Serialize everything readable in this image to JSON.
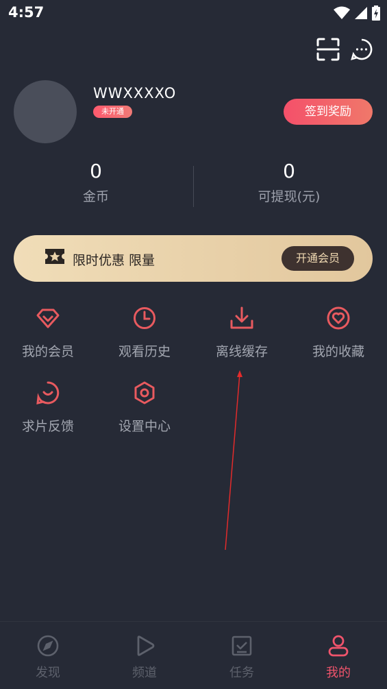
{
  "status_bar": {
    "time": "4:57"
  },
  "profile": {
    "username": "WWXXXXO",
    "vip_status": "未开通",
    "checkin_label": "签到奖励"
  },
  "stats": [
    {
      "value": "0",
      "label": "金币"
    },
    {
      "value": "0",
      "label": "可提现(元)"
    }
  ],
  "promo": {
    "text": "限时优惠 限量",
    "button_label": "开通会员"
  },
  "menu": [
    {
      "label": "我的会员",
      "icon": "diamond-icon"
    },
    {
      "label": "观看历史",
      "icon": "clock-icon"
    },
    {
      "label": "离线缓存",
      "icon": "download-icon"
    },
    {
      "label": "我的收藏",
      "icon": "heart-icon"
    },
    {
      "label": "求片反馈",
      "icon": "feedback-icon"
    },
    {
      "label": "设置中心",
      "icon": "settings-icon"
    }
  ],
  "bottom_nav": [
    {
      "label": "发现",
      "icon": "compass-icon",
      "active": false
    },
    {
      "label": "频道",
      "icon": "play-icon",
      "active": false
    },
    {
      "label": "任务",
      "icon": "task-icon",
      "active": false
    },
    {
      "label": "我的",
      "icon": "user-icon",
      "active": true
    }
  ],
  "colors": {
    "background": "#262a36",
    "accent": "#f0546c",
    "icon_red": "#e85a5f",
    "promo_gold": "#e9d2a9"
  }
}
